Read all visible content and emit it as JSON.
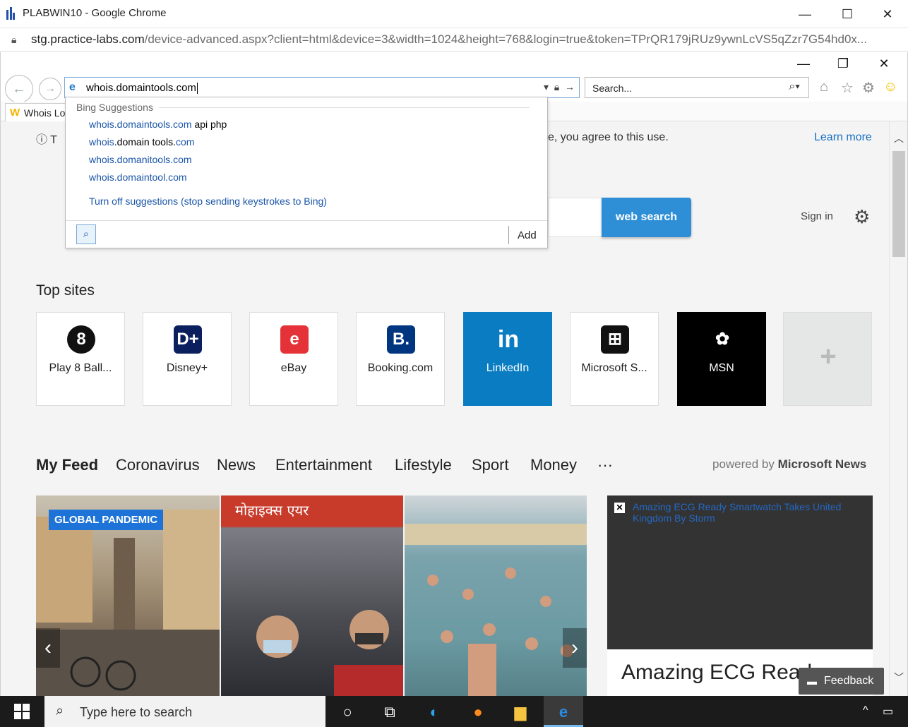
{
  "chrome": {
    "title": "PLABWIN10 - Google Chrome",
    "url_host": "stg.practice-labs.com",
    "url_path": "/device-advanced.aspx?client=html&device=3&width=1024&height=768&login=true&token=TPrQR179jRUz9ywnLcVS5qZzr7G54hd0x..."
  },
  "ie": {
    "address_value": "whois.domaintools.com",
    "search_placeholder": "Search...",
    "tab_label": "Whois Lo"
  },
  "suggestions": {
    "header": "Bing Suggestions",
    "items": [
      {
        "bold": "whois.domaintools.com",
        "rest": " api php"
      },
      {
        "bold": "whois",
        "mid": ".domain tools.",
        "end": "com"
      },
      {
        "bold": "whois",
        "mid": ".domanitools.",
        "end": "com"
      },
      {
        "bold": "whois",
        "mid": ".domaintool.",
        "end": "com"
      }
    ],
    "turn_off": "Turn off suggestions (stop sending keystrokes to Bing)",
    "add_label": "Add"
  },
  "page": {
    "cookie_prefix": "T",
    "cookie_text": "e, you agree to this use.",
    "learn_more": "Learn more",
    "web_search": "web search",
    "sign_in": "Sign in",
    "top_sites_title": "Top sites",
    "tiles": [
      {
        "label": "Play 8 Ball...",
        "icon": "8",
        "color": "#111"
      },
      {
        "label": "Disney+",
        "icon": "D+",
        "color": "#0b1f5e"
      },
      {
        "label": "eBay",
        "icon": "e",
        "color": "#e53238"
      },
      {
        "label": "Booking.com",
        "icon": "B.",
        "color": "#003580"
      },
      {
        "label": "LinkedIn",
        "icon": "in",
        "color": "#0a7dc2"
      },
      {
        "label": "Microsoft S...",
        "icon": "⊞",
        "color": "#111"
      },
      {
        "label": "MSN",
        "icon": "✿",
        "color": "#000"
      },
      {
        "label": "",
        "icon": "+",
        "color": "#ddd"
      }
    ],
    "feed_tabs": [
      "My Feed",
      "Coronavirus",
      "News",
      "Entertainment",
      "Lifestyle",
      "Sport",
      "Money",
      "···"
    ],
    "powered_prefix": "powered by ",
    "powered_brand": "Microsoft News",
    "badge": "GLOBAL PANDEMIC",
    "ad_text": "Amazing ECG Ready Smartwatch Takes United Kingdom By Storm",
    "ad_headline": "Amazing ECG Read",
    "feedback": "Feedback"
  },
  "taskbar": {
    "search_placeholder": "Type here to search"
  }
}
